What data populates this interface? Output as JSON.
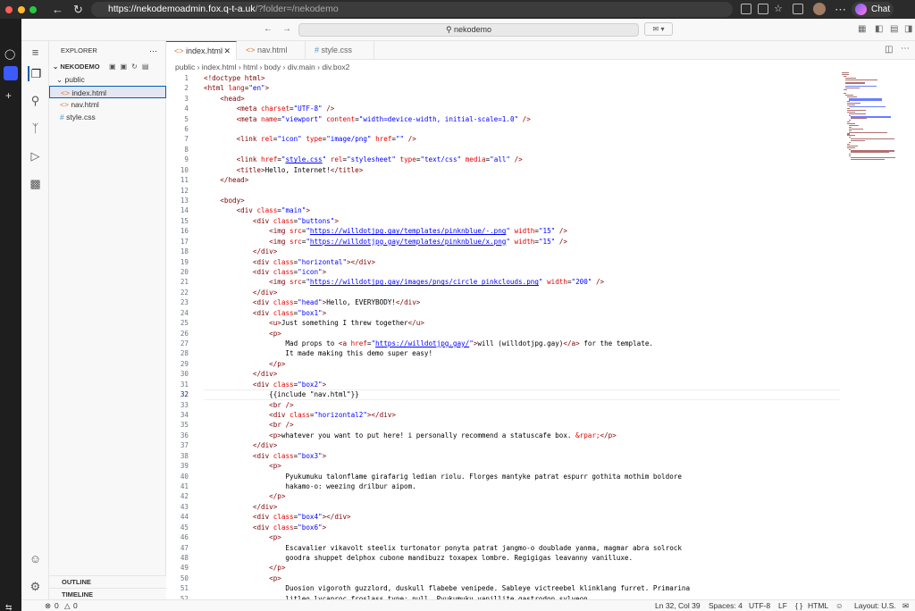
{
  "browser": {
    "url_host": "https://nekodemoadmin.fox.q-t-a.uk",
    "url_rest": "/?folder=/nekodemo",
    "chat_label": "Chat"
  },
  "vscode": {
    "search_label": "nekodemo"
  },
  "explorer": {
    "title": "EXPLORER",
    "root": "NEKODEMO",
    "folder": "public",
    "files": [
      {
        "name": "index.html",
        "icon": "<>",
        "selected": true
      },
      {
        "name": "nav.html",
        "icon": "<>",
        "selected": false
      },
      {
        "name": "style.css",
        "icon": "#",
        "selected": false
      }
    ],
    "outline": "OUTLINE",
    "timeline": "TIMELINE"
  },
  "tabs": [
    {
      "label": "index.html",
      "icon": "<>",
      "active": true
    },
    {
      "label": "nav.html",
      "icon": "<>",
      "active": false
    },
    {
      "label": "style.css",
      "icon": "#",
      "active": false
    }
  ],
  "breadcrumb": [
    "public",
    "index.html",
    "html",
    "body",
    "div.main",
    "div.box2"
  ],
  "editor": {
    "current_line": 32,
    "lines": [
      [
        [
          "doc",
          "<!doctype html>"
        ]
      ],
      [
        [
          "tag",
          "<html "
        ],
        [
          "attr",
          "lang"
        ],
        [
          "p",
          "="
        ],
        [
          "str",
          "\"en\""
        ],
        [
          "tag",
          ">"
        ]
      ],
      [
        [
          "p",
          "    "
        ],
        [
          "tag",
          "<head>"
        ]
      ],
      [
        [
          "p",
          "        "
        ],
        [
          "tag",
          "<meta "
        ],
        [
          "attr",
          "charset"
        ],
        [
          "p",
          "="
        ],
        [
          "str",
          "\"UTF-8\""
        ],
        [
          "p",
          " "
        ],
        [
          "tag",
          "/>"
        ]
      ],
      [
        [
          "p",
          "        "
        ],
        [
          "tag",
          "<meta "
        ],
        [
          "attr",
          "name"
        ],
        [
          "p",
          "="
        ],
        [
          "str",
          "\"viewport\""
        ],
        [
          "p",
          " "
        ],
        [
          "attr",
          "content"
        ],
        [
          "p",
          "="
        ],
        [
          "str",
          "\"width=device-width, initial-scale=1.0\""
        ],
        [
          "p",
          " "
        ],
        [
          "tag",
          "/>"
        ]
      ],
      [],
      [
        [
          "p",
          "        "
        ],
        [
          "tag",
          "<link "
        ],
        [
          "attr",
          "rel"
        ],
        [
          "p",
          "="
        ],
        [
          "str",
          "\"icon\""
        ],
        [
          "p",
          " "
        ],
        [
          "attr",
          "type"
        ],
        [
          "p",
          "="
        ],
        [
          "str",
          "\"image/png\""
        ],
        [
          "p",
          " "
        ],
        [
          "attr",
          "href"
        ],
        [
          "p",
          "="
        ],
        [
          "str",
          "\"\""
        ],
        [
          "p",
          " "
        ],
        [
          "tag",
          "/>"
        ]
      ],
      [],
      [
        [
          "p",
          "        "
        ],
        [
          "tag",
          "<link "
        ],
        [
          "attr",
          "href"
        ],
        [
          "p",
          "="
        ],
        [
          "str",
          "\""
        ],
        [
          "url",
          "style.css"
        ],
        [
          "str",
          "\""
        ],
        [
          "p",
          " "
        ],
        [
          "attr",
          "rel"
        ],
        [
          "p",
          "="
        ],
        [
          "str",
          "\"stylesheet\""
        ],
        [
          "p",
          " "
        ],
        [
          "attr",
          "type"
        ],
        [
          "p",
          "="
        ],
        [
          "str",
          "\"text/css\""
        ],
        [
          "p",
          " "
        ],
        [
          "attr",
          "media"
        ],
        [
          "p",
          "="
        ],
        [
          "str",
          "\"all\""
        ],
        [
          "p",
          " "
        ],
        [
          "tag",
          "/>"
        ]
      ],
      [
        [
          "p",
          "        "
        ],
        [
          "tag",
          "<title>"
        ],
        [
          "p",
          "Hello, Internet!"
        ],
        [
          "tag",
          "</title>"
        ]
      ],
      [
        [
          "p",
          "    "
        ],
        [
          "tag",
          "</head>"
        ]
      ],
      [],
      [
        [
          "p",
          "    "
        ],
        [
          "tag",
          "<body>"
        ]
      ],
      [
        [
          "p",
          "        "
        ],
        [
          "tag",
          "<div "
        ],
        [
          "attr",
          "class"
        ],
        [
          "p",
          "="
        ],
        [
          "str",
          "\"main\""
        ],
        [
          "tag",
          ">"
        ]
      ],
      [
        [
          "p",
          "            "
        ],
        [
          "tag",
          "<div "
        ],
        [
          "attr",
          "class"
        ],
        [
          "p",
          "="
        ],
        [
          "str",
          "\"buttons\""
        ],
        [
          "tag",
          ">"
        ]
      ],
      [
        [
          "p",
          "                "
        ],
        [
          "tag",
          "<img "
        ],
        [
          "attr",
          "src"
        ],
        [
          "p",
          "="
        ],
        [
          "str",
          "\""
        ],
        [
          "url",
          "https://willdotjpg.gay/templates/pinknblue/-.png"
        ],
        [
          "str",
          "\""
        ],
        [
          "p",
          " "
        ],
        [
          "attr",
          "width"
        ],
        [
          "p",
          "="
        ],
        [
          "str",
          "\"15\""
        ],
        [
          "p",
          " "
        ],
        [
          "tag",
          "/>"
        ]
      ],
      [
        [
          "p",
          "                "
        ],
        [
          "tag",
          "<img "
        ],
        [
          "attr",
          "src"
        ],
        [
          "p",
          "="
        ],
        [
          "str",
          "\""
        ],
        [
          "url",
          "https://willdotjpg.gay/templates/pinknblue/x.png"
        ],
        [
          "str",
          "\""
        ],
        [
          "p",
          " "
        ],
        [
          "attr",
          "width"
        ],
        [
          "p",
          "="
        ],
        [
          "str",
          "\"15\""
        ],
        [
          "p",
          " "
        ],
        [
          "tag",
          "/>"
        ]
      ],
      [
        [
          "p",
          "            "
        ],
        [
          "tag",
          "</div>"
        ]
      ],
      [
        [
          "p",
          "            "
        ],
        [
          "tag",
          "<div "
        ],
        [
          "attr",
          "class"
        ],
        [
          "p",
          "="
        ],
        [
          "str",
          "\"horizontal\""
        ],
        [
          "tag",
          "></div>"
        ]
      ],
      [
        [
          "p",
          "            "
        ],
        [
          "tag",
          "<div "
        ],
        [
          "attr",
          "class"
        ],
        [
          "p",
          "="
        ],
        [
          "str",
          "\"icon\""
        ],
        [
          "tag",
          ">"
        ]
      ],
      [
        [
          "p",
          "                "
        ],
        [
          "tag",
          "<img "
        ],
        [
          "attr",
          "src"
        ],
        [
          "p",
          "="
        ],
        [
          "str",
          "\""
        ],
        [
          "url",
          "https://willdotjpg.gay/images/pngs/circle_pinkclouds.png"
        ],
        [
          "str",
          "\""
        ],
        [
          "p",
          " "
        ],
        [
          "attr",
          "width"
        ],
        [
          "p",
          "="
        ],
        [
          "str",
          "\"200\""
        ],
        [
          "p",
          " "
        ],
        [
          "tag",
          "/>"
        ]
      ],
      [
        [
          "p",
          "            "
        ],
        [
          "tag",
          "</div>"
        ]
      ],
      [
        [
          "p",
          "            "
        ],
        [
          "tag",
          "<div "
        ],
        [
          "attr",
          "class"
        ],
        [
          "p",
          "="
        ],
        [
          "str",
          "\"head\""
        ],
        [
          "tag",
          ">"
        ],
        [
          "p",
          "Hello, EVERYBODY!"
        ],
        [
          "tag",
          "</div>"
        ]
      ],
      [
        [
          "p",
          "            "
        ],
        [
          "tag",
          "<div "
        ],
        [
          "attr",
          "class"
        ],
        [
          "p",
          "="
        ],
        [
          "str",
          "\"box1\""
        ],
        [
          "tag",
          ">"
        ]
      ],
      [
        [
          "p",
          "                "
        ],
        [
          "tag",
          "<u>"
        ],
        [
          "p",
          "Just something I threw together"
        ],
        [
          "tag",
          "</u>"
        ]
      ],
      [
        [
          "p",
          "                "
        ],
        [
          "tag",
          "<p>"
        ]
      ],
      [
        [
          "p",
          "                    Mad props to "
        ],
        [
          "tag",
          "<a "
        ],
        [
          "attr",
          "href"
        ],
        [
          "p",
          "="
        ],
        [
          "str",
          "\""
        ],
        [
          "url",
          "https://willdotjpg.gay/"
        ],
        [
          "str",
          "\""
        ],
        [
          "tag",
          ">"
        ],
        [
          "p",
          "will (willdotjpg.gay)"
        ],
        [
          "tag",
          "</a>"
        ],
        [
          "p",
          " for the template."
        ]
      ],
      [
        [
          "p",
          "                    It made making this demo super easy!"
        ]
      ],
      [
        [
          "p",
          "                "
        ],
        [
          "tag",
          "</p>"
        ]
      ],
      [
        [
          "p",
          "            "
        ],
        [
          "tag",
          "</div>"
        ]
      ],
      [
        [
          "p",
          "            "
        ],
        [
          "tag",
          "<div "
        ],
        [
          "attr",
          "class"
        ],
        [
          "p",
          "="
        ],
        [
          "str",
          "\"box2\""
        ],
        [
          "tag",
          ">"
        ]
      ],
      [
        [
          "p",
          "                {{include \"nav.html\"}}"
        ]
      ],
      [
        [
          "p",
          "                "
        ],
        [
          "tag",
          "<br "
        ],
        [
          "tag",
          "/>"
        ]
      ],
      [
        [
          "p",
          "                "
        ],
        [
          "tag",
          "<div "
        ],
        [
          "attr",
          "class"
        ],
        [
          "p",
          "="
        ],
        [
          "str",
          "\"horizontal2\""
        ],
        [
          "tag",
          "></div>"
        ]
      ],
      [
        [
          "p",
          "                "
        ],
        [
          "tag",
          "<br "
        ],
        [
          "tag",
          "/>"
        ]
      ],
      [
        [
          "p",
          "                "
        ],
        [
          "tag",
          "<p>"
        ],
        [
          "p",
          "whatever you want to put here! i personally recommend a statuscafe box. "
        ],
        [
          "attr",
          "&rpar;"
        ],
        [
          "tag",
          "</p>"
        ]
      ],
      [
        [
          "p",
          "            "
        ],
        [
          "tag",
          "</div>"
        ]
      ],
      [
        [
          "p",
          "            "
        ],
        [
          "tag",
          "<div "
        ],
        [
          "attr",
          "class"
        ],
        [
          "p",
          "="
        ],
        [
          "str",
          "\"box3\""
        ],
        [
          "tag",
          ">"
        ]
      ],
      [
        [
          "p",
          "                "
        ],
        [
          "tag",
          "<p>"
        ]
      ],
      [
        [
          "p",
          "                    Pyukumuku talonflame girafarig ledian riolu. Florges mantyke patrat espurr gothita mothim boldore"
        ]
      ],
      [
        [
          "p",
          "                    hakamo-o: weezing drilbur aipom."
        ]
      ],
      [
        [
          "p",
          "                "
        ],
        [
          "tag",
          "</p>"
        ]
      ],
      [
        [
          "p",
          "            "
        ],
        [
          "tag",
          "</div>"
        ]
      ],
      [
        [
          "p",
          "            "
        ],
        [
          "tag",
          "<div "
        ],
        [
          "attr",
          "class"
        ],
        [
          "p",
          "="
        ],
        [
          "str",
          "\"box4\""
        ],
        [
          "tag",
          "></div>"
        ]
      ],
      [
        [
          "p",
          "            "
        ],
        [
          "tag",
          "<div "
        ],
        [
          "attr",
          "class"
        ],
        [
          "p",
          "="
        ],
        [
          "str",
          "\"box6\""
        ],
        [
          "tag",
          ">"
        ]
      ],
      [
        [
          "p",
          "                "
        ],
        [
          "tag",
          "<p>"
        ]
      ],
      [
        [
          "p",
          "                    Escavalier vikavolt steelix turtonator ponyta patrat jangmo-o doublade yanma, magmar abra solrock"
        ]
      ],
      [
        [
          "p",
          "                    goodra shuppet delphox cubone mandibuzz toxapex lombre. Regigigas leavanny vanilluxe."
        ]
      ],
      [
        [
          "p",
          "                "
        ],
        [
          "tag",
          "</p>"
        ]
      ],
      [
        [
          "p",
          "                "
        ],
        [
          "tag",
          "<p>"
        ]
      ],
      [
        [
          "p",
          "                    Duosion vigoroth guzzlord, duskull flabebe venipede. Sableye victreebel klinklang furret. Primarina"
        ]
      ],
      [
        [
          "p",
          "                    litleo lycanroc froslass type: null. Pyukumuku vanillite gastrodon sylveon."
        ]
      ]
    ]
  },
  "status": {
    "errors": "0",
    "warnings": "0",
    "position": "Ln 32, Col 39",
    "spaces": "Spaces: 4",
    "encoding": "UTF-8",
    "eol": "LF",
    "language": "HTML",
    "layout": "Layout: U.S."
  },
  "colors": {
    "accent": "#005fb8",
    "tag": "#800000",
    "attr": "#e50000",
    "string": "#0000ff"
  }
}
